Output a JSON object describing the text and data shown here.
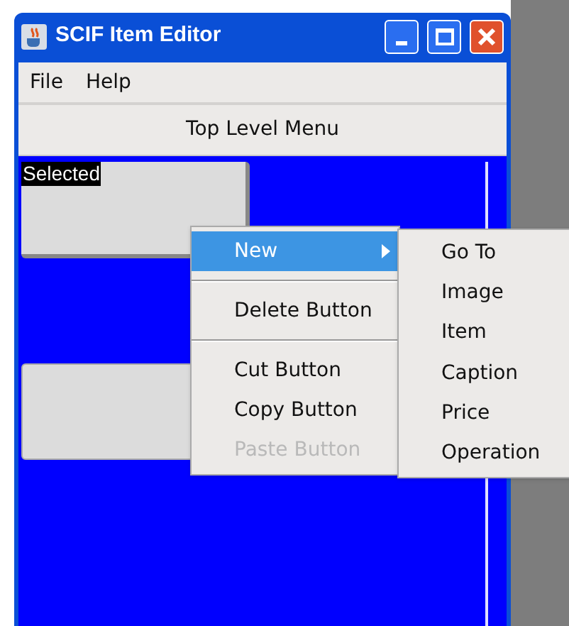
{
  "window": {
    "title": "SCIF Item Editor"
  },
  "menu_bar": [
    "File",
    "Help"
  ],
  "top_button": "Top Level Menu",
  "canvas": {
    "buttons": [
      {
        "label": "Selected",
        "selected": true
      },
      {
        "selected": false
      }
    ]
  },
  "context_menu": {
    "items": [
      {
        "kind": "item",
        "label": "New",
        "selected": true,
        "submenu": true,
        "disabled": false
      },
      {
        "kind": "separator"
      },
      {
        "kind": "item",
        "label": "Delete Button",
        "selected": false,
        "submenu": false,
        "disabled": false
      },
      {
        "kind": "separator"
      },
      {
        "kind": "item",
        "label": "Cut Button",
        "selected": false,
        "submenu": false,
        "disabled": false
      },
      {
        "kind": "item",
        "label": "Copy Button",
        "selected": false,
        "submenu": false,
        "disabled": false
      },
      {
        "kind": "item",
        "label": "Paste Button",
        "selected": false,
        "submenu": false,
        "disabled": true
      }
    ]
  },
  "submenu": [
    "Go To",
    "Image",
    "Item",
    "Caption",
    "Price",
    "Operation"
  ]
}
